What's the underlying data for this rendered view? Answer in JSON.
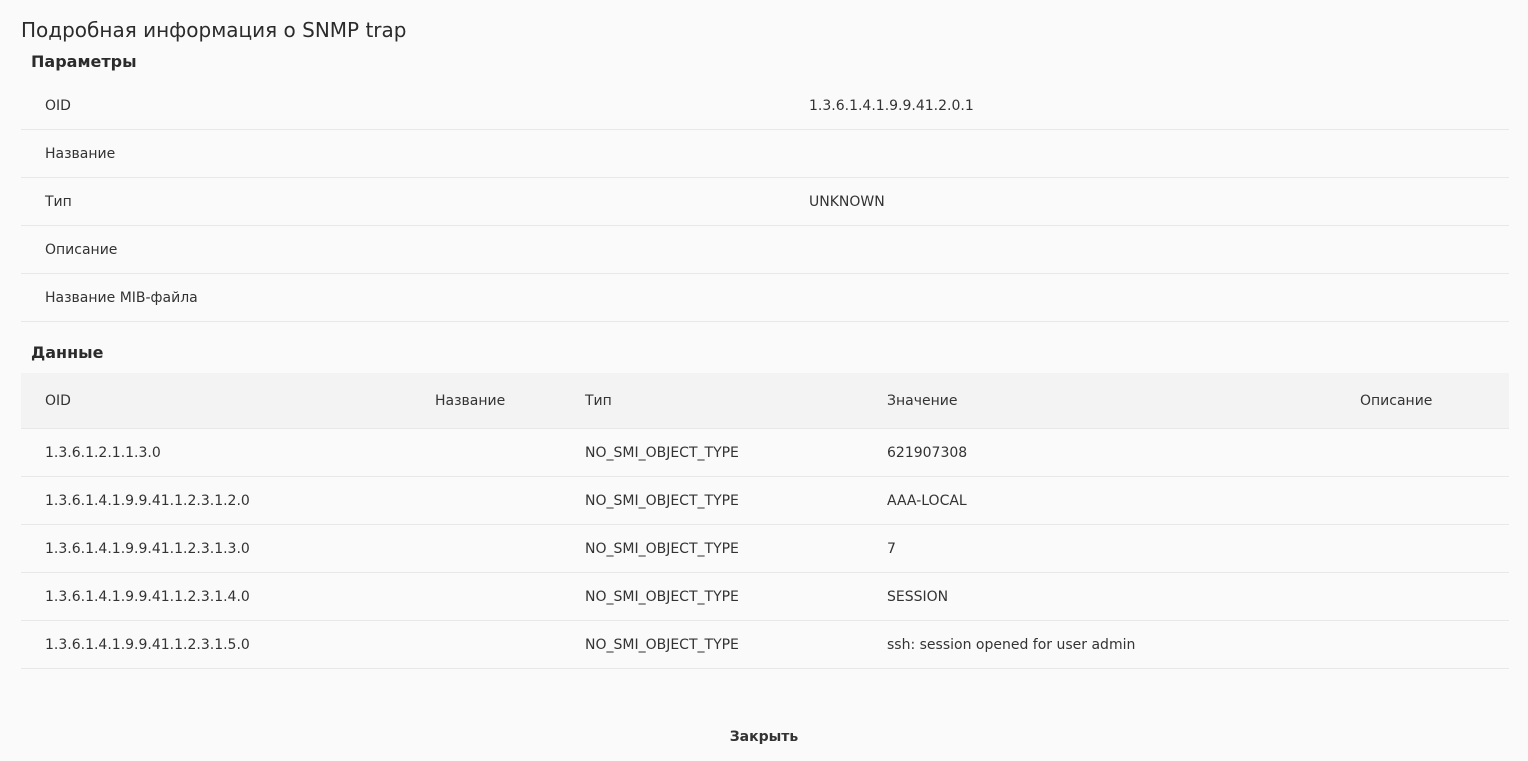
{
  "dialog": {
    "title": "Подробная информация о SNMP trap",
    "close_label": "Закрыть"
  },
  "params": {
    "section_title": "Параметры",
    "rows": [
      {
        "label": "OID",
        "value": "1.3.6.1.4.1.9.9.41.2.0.1"
      },
      {
        "label": "Название",
        "value": ""
      },
      {
        "label": "Тип",
        "value": "UNKNOWN"
      },
      {
        "label": "Описание",
        "value": ""
      },
      {
        "label": "Название MIB-файла",
        "value": ""
      }
    ]
  },
  "data": {
    "section_title": "Данные",
    "columns": {
      "oid": "OID",
      "name": "Название",
      "type": "Тип",
      "value": "Значение",
      "description": "Описание"
    },
    "rows": [
      {
        "oid": "1.3.6.1.2.1.1.3.0",
        "name": "",
        "type": "NO_SMI_OBJECT_TYPE",
        "value": "621907308",
        "description": ""
      },
      {
        "oid": "1.3.6.1.4.1.9.9.41.1.2.3.1.2.0",
        "name": "",
        "type": "NO_SMI_OBJECT_TYPE",
        "value": "AAA-LOCAL",
        "description": ""
      },
      {
        "oid": "1.3.6.1.4.1.9.9.41.1.2.3.1.3.0",
        "name": "",
        "type": "NO_SMI_OBJECT_TYPE",
        "value": "7",
        "description": ""
      },
      {
        "oid": "1.3.6.1.4.1.9.9.41.1.2.3.1.4.0",
        "name": "",
        "type": "NO_SMI_OBJECT_TYPE",
        "value": "SESSION",
        "description": ""
      },
      {
        "oid": "1.3.6.1.4.1.9.9.41.1.2.3.1.5.0",
        "name": "",
        "type": "NO_SMI_OBJECT_TYPE",
        "value": "ssh: session opened for user admin",
        "description": ""
      }
    ]
  }
}
